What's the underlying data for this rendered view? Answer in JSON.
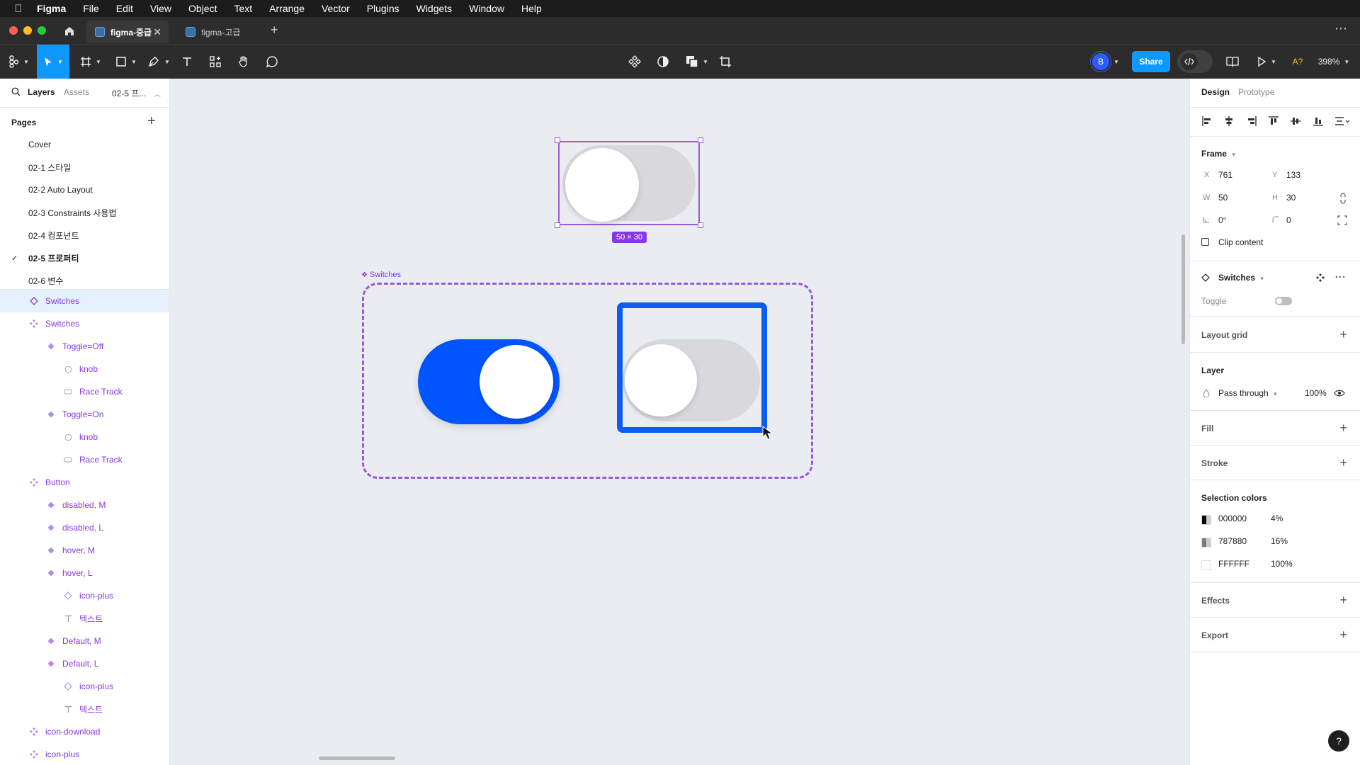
{
  "menubar": {
    "app": "Figma",
    "items": [
      "File",
      "Edit",
      "View",
      "Object",
      "Text",
      "Arrange",
      "Vector",
      "Plugins",
      "Widgets",
      "Window",
      "Help"
    ]
  },
  "tabs": [
    {
      "label": "figma-중급",
      "active": true
    },
    {
      "label": "figma-고급",
      "active": false
    }
  ],
  "toolbar": {
    "avatar_letter": "B",
    "share_label": "Share",
    "zoom": "398%",
    "ai_label": "A?"
  },
  "left_panel": {
    "tabs": {
      "layers": "Layers",
      "assets": "Assets",
      "page": "02-5 프..."
    },
    "pages_title": "Pages",
    "pages": [
      {
        "label": "Cover",
        "current": false
      },
      {
        "label": "02-1 스타일",
        "current": false
      },
      {
        "label": "02-2 Auto Layout",
        "current": false
      },
      {
        "label": "02-3 Constraints 사용법",
        "current": false
      },
      {
        "label": "02-4 컴포넌트",
        "current": false
      },
      {
        "label": "02-5 프로퍼티",
        "current": true
      },
      {
        "label": "02-6 변수",
        "current": false
      }
    ],
    "layers": [
      {
        "label": "Switches",
        "indent": 0,
        "icon": "component-outline",
        "selected": true
      },
      {
        "label": "Switches",
        "indent": 0,
        "icon": "component-set"
      },
      {
        "label": "Toggle=Off",
        "indent": 1,
        "icon": "variant"
      },
      {
        "label": "knob",
        "indent": 2,
        "icon": "ellipse"
      },
      {
        "label": "Race Track",
        "indent": 2,
        "icon": "rounded-rect"
      },
      {
        "label": "Toggle=On",
        "indent": 1,
        "icon": "variant"
      },
      {
        "label": "knob",
        "indent": 2,
        "icon": "ellipse"
      },
      {
        "label": "Race Track",
        "indent": 2,
        "icon": "rounded-rect"
      },
      {
        "label": "Button",
        "indent": 0,
        "icon": "component-set"
      },
      {
        "label": "disabled, M",
        "indent": 1,
        "icon": "variant"
      },
      {
        "label": "disabled, L",
        "indent": 1,
        "icon": "variant"
      },
      {
        "label": "hover, M",
        "indent": 1,
        "icon": "variant"
      },
      {
        "label": "hover, L",
        "indent": 1,
        "icon": "variant"
      },
      {
        "label": "icon-plus",
        "indent": 2,
        "icon": "instance"
      },
      {
        "label": "텍스트",
        "indent": 2,
        "icon": "text"
      },
      {
        "label": "Default, M",
        "indent": 1,
        "icon": "variant"
      },
      {
        "label": "Default, L",
        "indent": 1,
        "icon": "variant"
      },
      {
        "label": "icon-plus",
        "indent": 2,
        "icon": "instance"
      },
      {
        "label": "텍스트",
        "indent": 2,
        "icon": "text"
      },
      {
        "label": "icon-download",
        "indent": 0,
        "icon": "component-set"
      },
      {
        "label": "icon-plus",
        "indent": 0,
        "icon": "component-set"
      }
    ]
  },
  "canvas": {
    "size_badge": "50 × 30",
    "frame_label": "Switches"
  },
  "right_panel": {
    "tabs": {
      "design": "Design",
      "prototype": "Prototype"
    },
    "frame": {
      "title": "Frame",
      "x_label": "X",
      "x": "761",
      "y_label": "Y",
      "y": "133",
      "w_label": "W",
      "w": "50",
      "h_label": "H",
      "h": "30",
      "rotation": "0°",
      "radius": "0",
      "clip": "Clip content"
    },
    "component": {
      "name": "Switches",
      "prop": "Toggle",
      "prop_value_on": false
    },
    "layout_grid": "Layout grid",
    "layer": {
      "title": "Layer",
      "blend": "Pass through",
      "opacity": "100%"
    },
    "fill": "Fill",
    "stroke": "Stroke",
    "selection_colors": {
      "title": "Selection colors",
      "items": [
        {
          "hex": "000000",
          "opacity": "4%",
          "color": "#000000"
        },
        {
          "hex": "787880",
          "opacity": "16%",
          "color": "#787880"
        },
        {
          "hex": "FFFFFF",
          "opacity": "100%",
          "color": "#FFFFFF"
        }
      ]
    },
    "effects": "Effects",
    "export": "Export"
  },
  "colors": {
    "accent": "#0d99ff",
    "purple": "#8638e5",
    "toggle_blue": "#0055ff"
  }
}
